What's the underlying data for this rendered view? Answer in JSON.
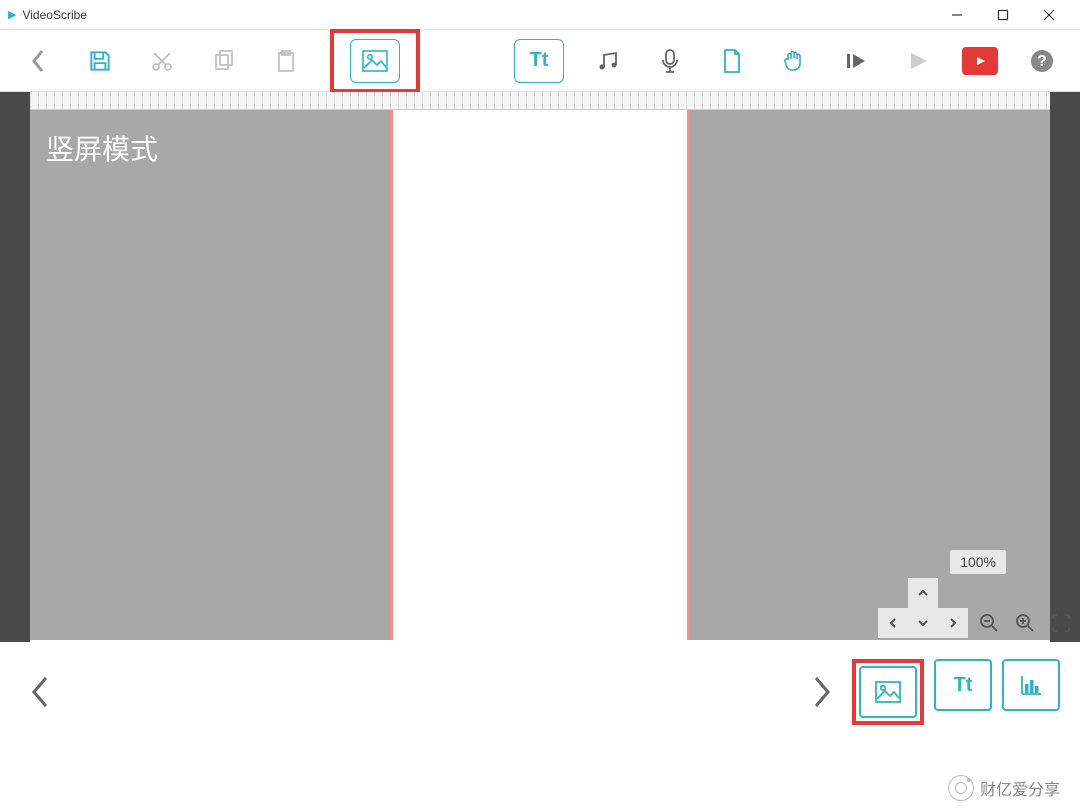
{
  "titlebar": {
    "title": "VideoScribe"
  },
  "toolbar": {
    "icons": {
      "back": "back-icon",
      "save": "save-icon",
      "cut": "cut-icon",
      "copy": "copy-icon",
      "paste": "paste-icon",
      "image": "image-icon",
      "text": "Tt",
      "music": "music-icon",
      "mic": "microphone-icon",
      "page": "page-icon",
      "hand": "hand-icon",
      "play_from": "play-from-icon",
      "play": "play-icon",
      "export": "export-video-icon",
      "help": "help-icon"
    }
  },
  "canvas": {
    "mode_label": "竖屏模式"
  },
  "zoom": {
    "level": "100%"
  },
  "timeline": {
    "tools": {
      "image": "image-icon",
      "text": "Tt",
      "chart": "chart-icon"
    }
  },
  "watermark": {
    "text": "财亿爱分享"
  }
}
